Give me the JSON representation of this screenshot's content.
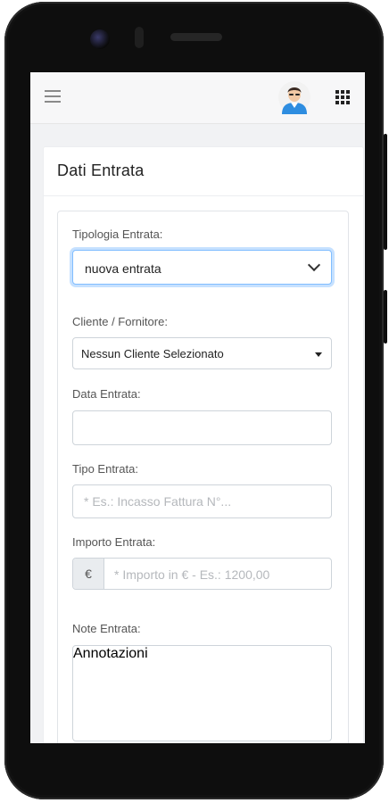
{
  "header": {
    "menu_icon": "hamburger-icon",
    "avatar_icon": "user-avatar",
    "apps_icon": "grid-apps-icon"
  },
  "card": {
    "title": "Dati Entrata"
  },
  "form": {
    "tipologia": {
      "label": "Tipologia Entrata:",
      "value": "nuova entrata"
    },
    "cliente": {
      "label": "Cliente / Fornitore:",
      "value": "Nessun Cliente Selezionato"
    },
    "data": {
      "label": "Data Entrata:",
      "value": ""
    },
    "tipo": {
      "label": "Tipo Entrata:",
      "placeholder": "* Es.: Incasso Fattura N°..."
    },
    "importo": {
      "label": "Importo Entrata:",
      "currency": "€",
      "placeholder": "* Importo in € - Es.: 1200,00"
    },
    "note": {
      "label": "Note Entrata:",
      "placeholder": "Annotazioni"
    }
  },
  "colors": {
    "focus_border": "#80bdff",
    "avatar_shirt": "#2e8de0"
  }
}
